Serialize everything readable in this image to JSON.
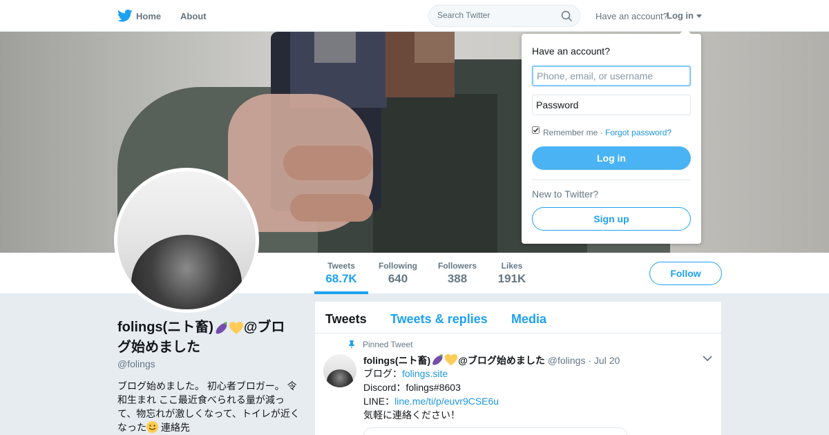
{
  "nav": {
    "home_label": "Home",
    "about_label": "About",
    "search_placeholder": "Search Twitter",
    "have_account": "Have an account?",
    "login_label": "Log in",
    "icons": {
      "logo": "twitter-bird-icon",
      "search": "search-icon",
      "dropdown": "caret-down-icon"
    }
  },
  "profile": {
    "name": "folings(ニト畜)",
    "name_suffix": "@ブログ始めました",
    "name_emojis": [
      "eggplant-emoji",
      "yellow-heart-emoji"
    ],
    "handle": "@folings",
    "bio_text": "ブログ始めました。 初心者ブロガー。 令和生まれ ここ最近食べられる量が減って、物忘れが激しくなって、トイレが近くなった",
    "bio_emoji": "smiley-emoji",
    "bio_after": " 連絡先"
  },
  "stats": [
    {
      "label": "Tweets",
      "value": "68.7K",
      "active": true
    },
    {
      "label": "Following",
      "value": "640",
      "active": false
    },
    {
      "label": "Followers",
      "value": "388",
      "active": false
    },
    {
      "label": "Likes",
      "value": "191K",
      "active": false
    }
  ],
  "follow_button": "Follow",
  "timeline": {
    "tabs": [
      "Tweets",
      "Tweets & replies",
      "Media"
    ],
    "active_tab": "Tweets",
    "pinned_label": "Pinned Tweet",
    "tweet": {
      "name": "folings(ニト畜)",
      "name_suffix": "@ブログ始めました",
      "handle": "@folings",
      "separator": " · ",
      "date": "Jul 20",
      "lines": [
        {
          "prefix": "ブログ：",
          "link": "folings.site"
        },
        {
          "prefix": "Discord：folings#8603",
          "link": ""
        },
        {
          "prefix": "LINE：",
          "link": "line.me/ti/p/euvr9CSE6u"
        },
        {
          "prefix": "気軽に連絡ください！",
          "link": ""
        }
      ]
    }
  },
  "login_dropdown": {
    "title": "Have an account?",
    "username_placeholder": "Phone, email, or username",
    "password_placeholder": "Password",
    "remember_label": "Remember me",
    "separator": " · ",
    "forgot_label": "Forgot password?",
    "remember_checked": true,
    "login_button": "Log in",
    "new_label": "New to Twitter?",
    "signup_button": "Sign up"
  },
  "colors": {
    "accent": "#1da1f2",
    "login_button_bg": "#4ab3f4",
    "link": "#1b95e0",
    "page_bg": "#e6ecf0",
    "muted_text": "#657786"
  }
}
